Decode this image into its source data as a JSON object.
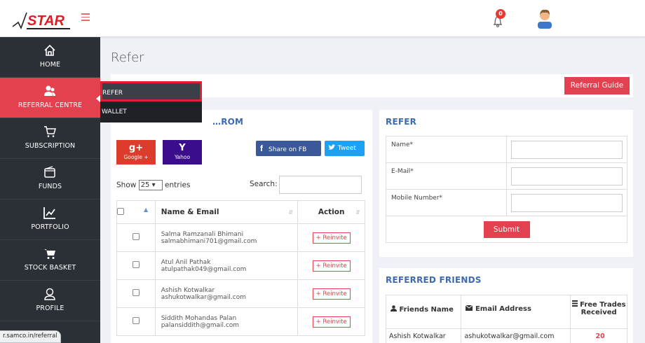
{
  "app": {
    "logo_text": "STAR"
  },
  "header": {
    "notification_count": "0"
  },
  "sidebar": {
    "items": [
      {
        "label": "HOME"
      },
      {
        "label": "REFERRAL CENTRE"
      },
      {
        "label": "SUBSCRIPTION"
      },
      {
        "label": "FUNDS"
      },
      {
        "label": "PORTFOLIO"
      },
      {
        "label": "STOCK BASKET"
      },
      {
        "label": "PROFILE"
      }
    ]
  },
  "flyout": {
    "items": [
      {
        "label": "REFER"
      },
      {
        "label": "WALLET"
      }
    ]
  },
  "page": {
    "title": "Refer",
    "guide_button": "Referral Guide"
  },
  "invite": {
    "title_partial": "…ROM",
    "google_label": "Google +",
    "google_icon": "g+",
    "yahoo_label": "Yahoo",
    "yahoo_icon": "Y",
    "fb_label": "Share on FB",
    "tweet_label": "Tweet",
    "show_prefix": "Show",
    "show_value": "25",
    "show_suffix": "entries",
    "search_label": "Search:",
    "columns": {
      "name": "Name & Email",
      "action": "Action"
    },
    "reinvite_label": "Reinvite",
    "rows": [
      {
        "name": "Salma Ramzanali Bhimani",
        "email": "salmabhimani701@gmail.com"
      },
      {
        "name": "Atul Anil Pathak",
        "email": "atulpathak049@gmail.com"
      },
      {
        "name": "Ashish Kotwalkar",
        "email": "ashukotwalkar@gmail.com"
      },
      {
        "name": "Siddith Mohandas Palan",
        "email": "palansiddith@gmail.com"
      }
    ]
  },
  "refer": {
    "title": "REFER",
    "fields": [
      {
        "label": "Name*"
      },
      {
        "label": "E-Mail*"
      },
      {
        "label": "Mobile Number*"
      }
    ],
    "submit": "Submit"
  },
  "referred": {
    "title": "REFERRED FRIENDS",
    "columns": {
      "friend": "Friends Name",
      "email": "Email Address",
      "trades_1": "Free Trades",
      "trades_2": "Received"
    },
    "rows": [
      {
        "name": "Ashish Kotwalkar",
        "email": "ashukotwalkar@gmail.com",
        "trades": "20"
      }
    ]
  },
  "status_bar": {
    "url": "r.samco.in/referral"
  },
  "colors": {
    "accent": "#e34050",
    "sidebar": "#2b2f36",
    "title_blue": "#3d6ab0"
  }
}
